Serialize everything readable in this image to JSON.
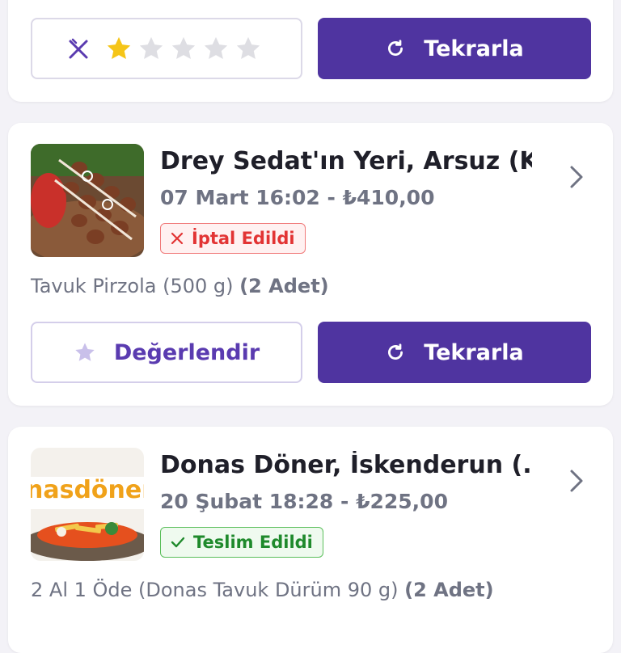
{
  "orders": [
    {
      "rating": {
        "filled": 1,
        "total": 5
      },
      "reorder_label": "Tekrarla"
    },
    {
      "restaurant": "Drey Sedat'ın Yeri, Arsuz (K...",
      "date_time": "07 Mart 16:02",
      "separator": " - ",
      "price": "₺410,00",
      "status": "İptal Edildi",
      "status_color": "#e23434",
      "item": "Tavuk Pirzola (500 g) ",
      "quantity": "(2 Adet)",
      "rate_label": "Değerlendir",
      "reorder_label": "Tekrarla"
    },
    {
      "restaurant": "Donas Döner, İskenderun (...",
      "date_time": "20 Şubat 18:28",
      "separator": " - ",
      "price": "₺225,00",
      "status": "Teslim Edildi",
      "status_color": "#1f8a2c",
      "item": "2 Al 1 Öde (Donas Tavuk Dürüm 90 g) ",
      "quantity": "(2 Adet)",
      "thumb_text": "nasdöner"
    }
  ],
  "colors": {
    "primary": "#4f34a0",
    "star_filled": "#f5c518",
    "star_empty": "#dedee3"
  }
}
